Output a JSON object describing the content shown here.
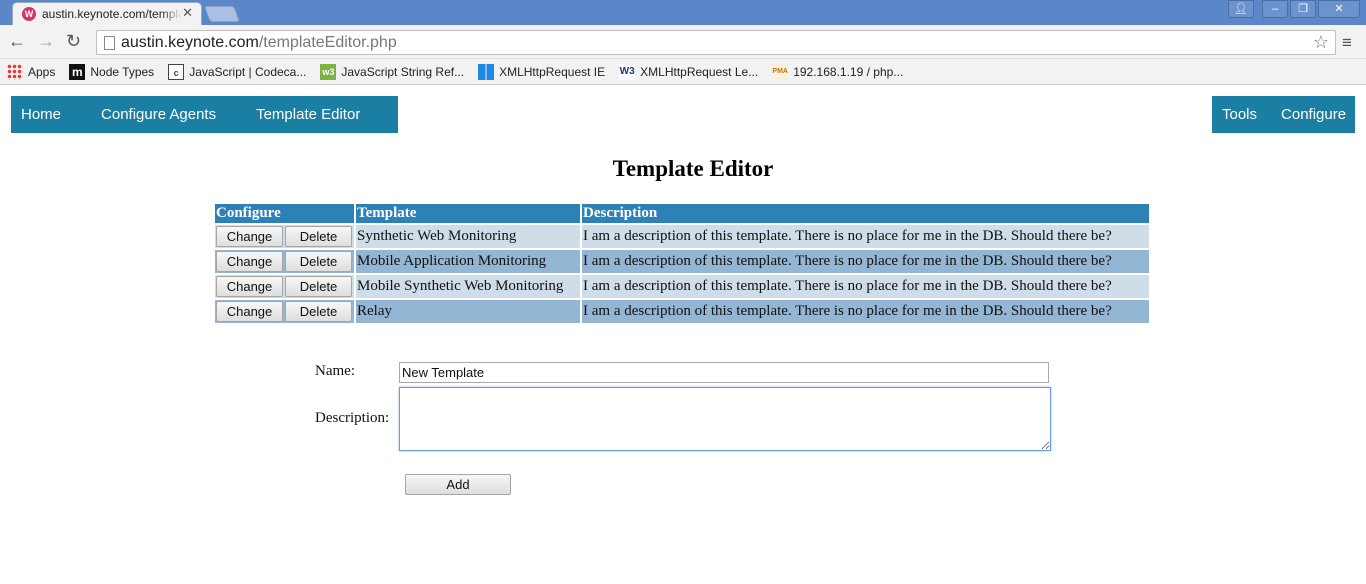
{
  "browser": {
    "tab_title": "austin.keynote.com/templateEditor.php",
    "url_host": "austin.keynote.com",
    "url_path": "/templateEditor.php",
    "bookmarks": [
      {
        "label": "Apps",
        "icon": "apps-grid-icon"
      },
      {
        "label": "Node Types",
        "icon": "m-logo-icon"
      },
      {
        "label": "JavaScript | Codeca...",
        "icon": "codecademy-icon"
      },
      {
        "label": "JavaScript String Ref...",
        "icon": "w3schools-icon"
      },
      {
        "label": "XMLHttpRequest IE",
        "icon": "windows-icon"
      },
      {
        "label": "XMLHttpRequest Le...",
        "icon": "w3c-icon"
      },
      {
        "label": "192.168.1.19 / php...",
        "icon": "phpmyadmin-icon"
      }
    ]
  },
  "nav": {
    "left": [
      "Home",
      "Configure Agents",
      "Template Editor"
    ],
    "right": [
      "Tools",
      "Configure"
    ],
    "color": "#1b7fa3"
  },
  "page": {
    "title": "Template Editor",
    "table": {
      "headers": [
        "Configure",
        "Template",
        "Description"
      ],
      "change_label": "Change",
      "delete_label": "Delete",
      "rows": [
        {
          "template": "Synthetic Web Monitoring",
          "description": "I am a description of this template. There is no place for me in the DB. Should there be?"
        },
        {
          "template": "Mobile Application Monitoring",
          "description": "I am a description of this template. There is no place for me in the DB. Should there be?"
        },
        {
          "template": "Mobile Synthetic Web Monitoring",
          "description": "I am a description of this template. There is no place for me in the DB. Should there be?"
        },
        {
          "template": "Relay",
          "description": "I am a description of this template. There is no place for me in the DB. Should there be?"
        }
      ]
    },
    "form": {
      "name_label": "Name:",
      "name_value": "New Template",
      "description_label": "Description:",
      "description_value": "",
      "add_label": "Add"
    }
  }
}
